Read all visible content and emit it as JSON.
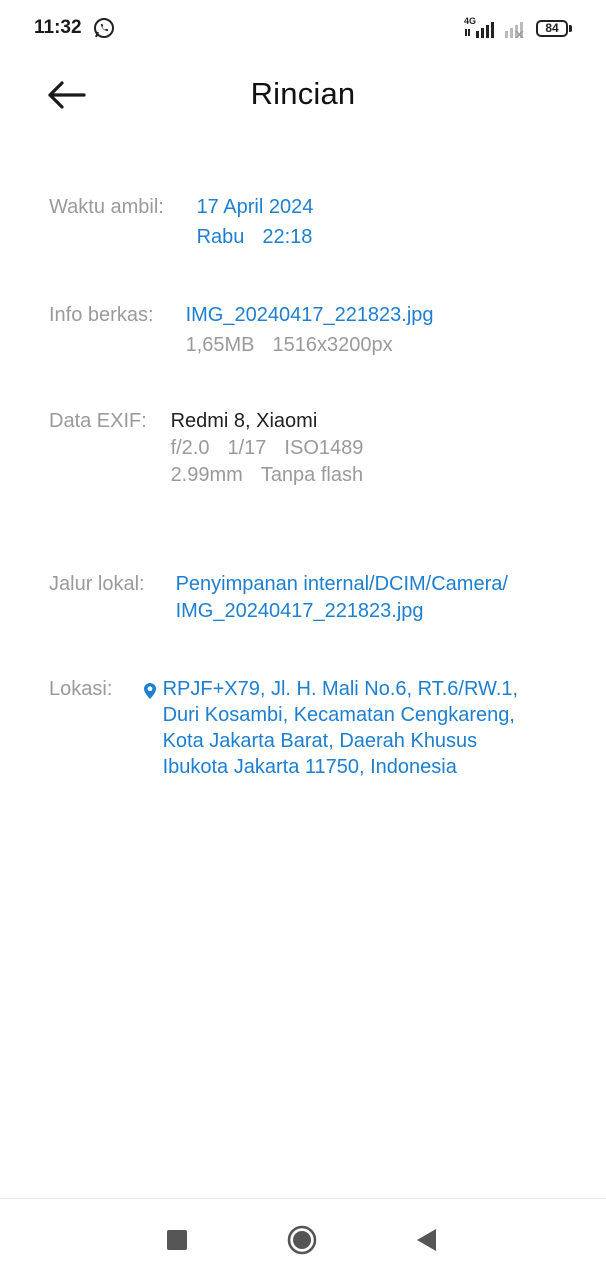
{
  "status_bar": {
    "time": "11:32",
    "network": "4G",
    "battery": "84",
    "icons": [
      "whatsapp-icon",
      "signal-icon",
      "battery-icon"
    ]
  },
  "header": {
    "title": "Rincian",
    "back_icon": "arrow-left-icon"
  },
  "details": {
    "time_taken": {
      "label": "Waktu ambil:",
      "date": "17 April 2024",
      "day": "Rabu",
      "time": "22:18"
    },
    "file_info": {
      "label": "Info berkas:",
      "filename": "IMG_20240417_221823.jpg",
      "size": "1,65MB",
      "resolution": "1516x3200px"
    },
    "exif": {
      "label": "Data EXIF:",
      "device": "Redmi 8, Xiaomi",
      "aperture": "f/2.0",
      "shutter": "1/17",
      "iso": "ISO1489",
      "focal_length": "2.99mm",
      "flash": "Tanpa flash"
    },
    "local_path": {
      "label": "Jalur lokal:",
      "line1": "Penyimpanan internal/DCIM/Camera/",
      "line2": "IMG_20240417_221823.jpg"
    },
    "location": {
      "label": "Lokasi:",
      "icon": "location-pin-icon",
      "line1": "RPJF+X79, Jl. H. Mali No.6, RT.6/RW.1,",
      "line2": "Duri Kosambi, Kecamatan Cengkareng,",
      "line3": "Kota Jakarta Barat, Daerah Khusus",
      "line4": "Ibukota Jakarta 11750, Indonesia"
    }
  },
  "nav_bar": {
    "icons": [
      "recent-apps-icon",
      "home-icon",
      "back-icon"
    ]
  },
  "colors": {
    "accent": "#1e7fd0",
    "label": "#9a9a9a",
    "text": "#222222"
  }
}
